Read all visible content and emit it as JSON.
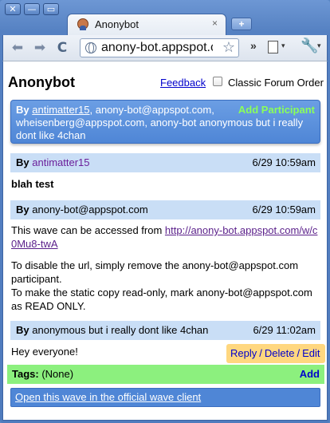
{
  "window": {
    "controls": [
      "✕",
      "—",
      "▭"
    ]
  },
  "tab": {
    "title": "Anonybot",
    "close": "×",
    "new_tab": "+"
  },
  "toolbar": {
    "back": "⬅",
    "forward": "➡",
    "reload": "C",
    "url": "anony-bot.appspot.c",
    "star": "☆",
    "overflow": "»",
    "dropdown": "▾",
    "wrench": "🔧"
  },
  "app": {
    "title": "Anonybot",
    "feedback": "Feedback",
    "classic_order_label": "Classic Forum Order"
  },
  "participants": {
    "by_label": "By",
    "first": "antimatter15",
    "rest": ", anony-bot@appspot.com, wheisenberg@appspot.com, anony-bot anonymous but i really dont like 4chan",
    "add_label": "Add Participant"
  },
  "blips": [
    {
      "by_label": "By",
      "author": "antimatter15",
      "time": "6/29 10:59am",
      "body": "blah test"
    },
    {
      "by_label": "By",
      "author": "anony-bot@appspot.com",
      "time": "6/29 10:59am",
      "body_prefix": "This wave can be accessed from ",
      "link": "http://anony-bot.appspot.com/w/c0Mu8-twA",
      "para2": "To disable the url, simply remove the anony-bot@appspot.com participant.",
      "para3": "To make the static copy read-only, mark anony-bot@appspot.com as READ ONLY."
    },
    {
      "by_label": "By",
      "author": "anonymous but i really dont like 4chan",
      "time": "6/29 11:02am",
      "body": "Hey everyone!"
    }
  ],
  "actions": {
    "reply": "Reply",
    "delete": "Delete",
    "edit": "Edit",
    "sep": "/"
  },
  "tags": {
    "label": "Tags:",
    "value": "(None)",
    "add": "Add"
  },
  "footer": {
    "open_wave": "Open this wave in the official wave client"
  }
}
